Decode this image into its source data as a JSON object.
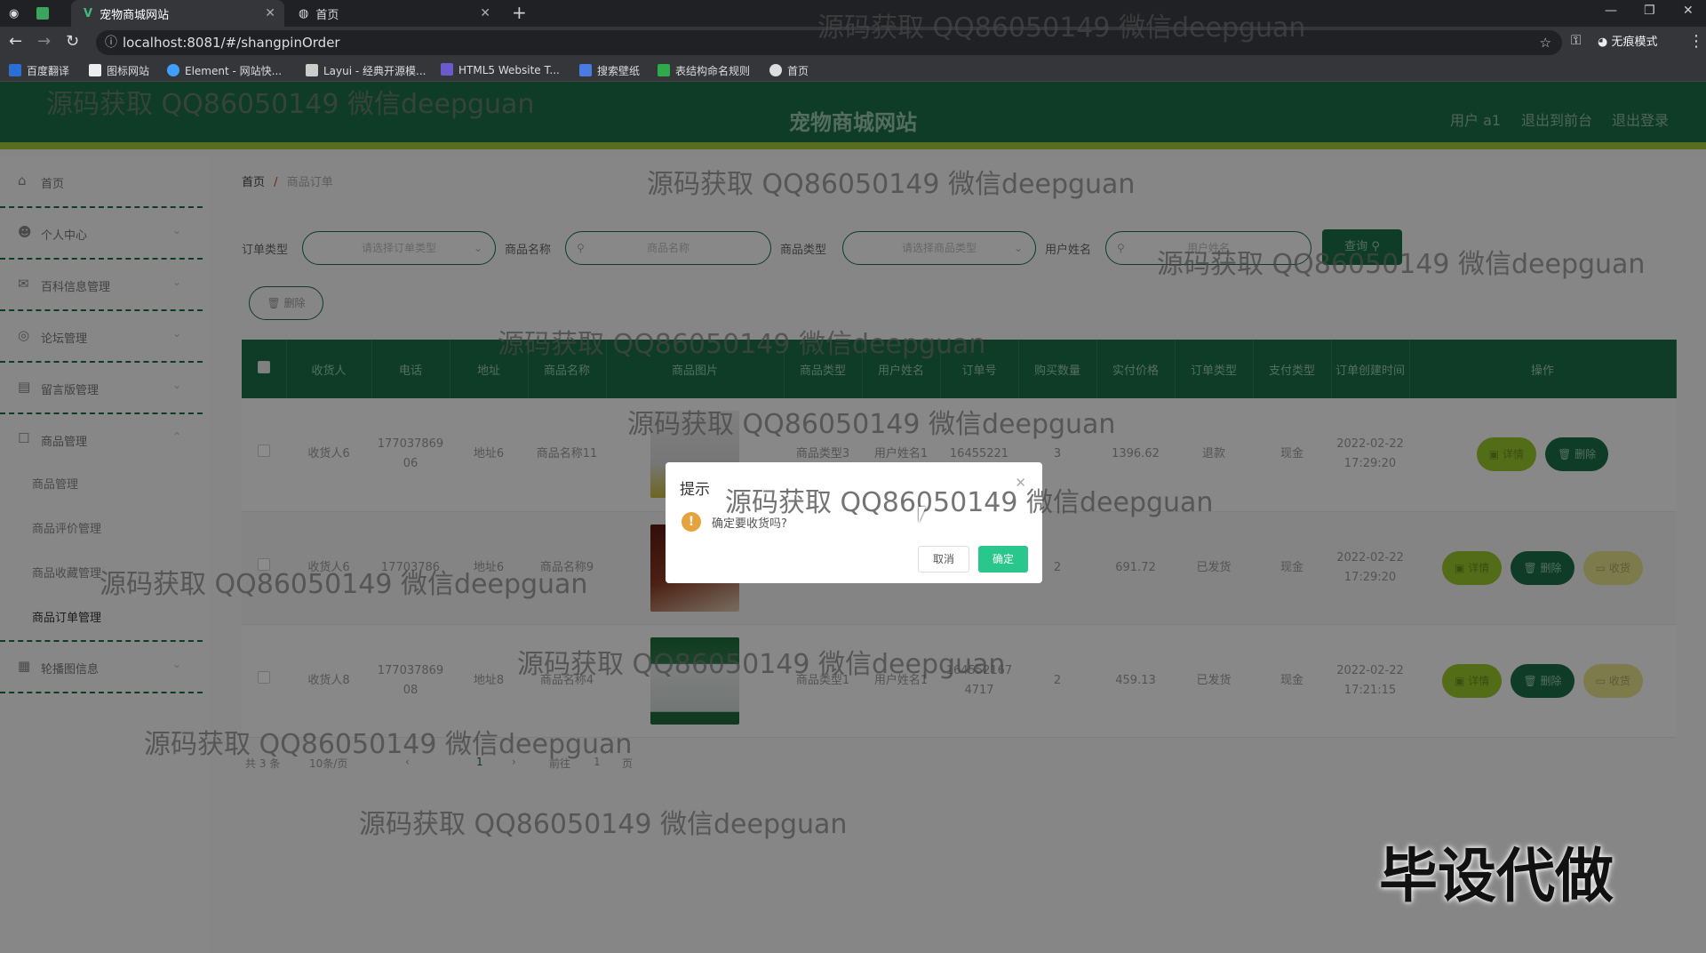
{
  "browser": {
    "tabs": [
      {
        "title": "宠物商城网站",
        "active": true
      },
      {
        "title": "首页",
        "active": false
      }
    ],
    "url": "localhost:8081/#/shangpinOrder",
    "incognito_label": "无痕模式",
    "bookmarks": [
      "百度翻译",
      "图标网站",
      "Element - 网站快...",
      "Layui - 经典开源模...",
      "HTML5 Website T...",
      "搜索壁纸",
      "表结构命名规则",
      "首页"
    ]
  },
  "header": {
    "title": "宠物商城网站",
    "user": "用户 a1",
    "to_front": "退出到前台",
    "logout": "退出登录"
  },
  "sidebar": {
    "items": [
      {
        "label": "首页",
        "icon": "home-icon"
      },
      {
        "label": "个人中心",
        "icon": "user-icon"
      },
      {
        "label": "百科信息管理",
        "icon": "mail-icon"
      },
      {
        "label": "论坛管理",
        "icon": "forum-icon"
      },
      {
        "label": "留言版管理",
        "icon": "message-icon"
      },
      {
        "label": "商品管理",
        "icon": "box-icon"
      },
      {
        "label": "轮播图信息",
        "icon": "grid-icon"
      }
    ],
    "sub_items": [
      "商品管理",
      "商品评价管理",
      "商品收藏管理",
      "商品订单管理"
    ]
  },
  "breadcrumb": {
    "home": "首页",
    "sep": "/",
    "current": "商品订单"
  },
  "filters": {
    "order_type_label": "订单类型",
    "order_type_placeholder": "请选择订单类型",
    "product_name_label": "商品名称",
    "product_name_placeholder": "商品名称",
    "product_type_label": "商品类型",
    "product_type_placeholder": "请选择商品类型",
    "user_name_label": "用户姓名",
    "user_name_placeholder": "用户姓名",
    "search_label": "查询",
    "delete_label": "删除"
  },
  "table": {
    "headers": [
      "收货人",
      "电话",
      "地址",
      "商品名称",
      "商品图片",
      "商品类型",
      "用户姓名",
      "订单号",
      "购买数量",
      "实付价格",
      "订单类型",
      "支付类型",
      "订单创建时间",
      "操作"
    ],
    "rows": [
      {
        "receiver": "收货人6",
        "phone": "17703786906",
        "address": "地址6",
        "product": "商品名称11",
        "ptype": "商品类型3",
        "user": "用户姓名1",
        "order_no": "16455221",
        "qty": "3",
        "price": "1396.62",
        "otype": "退款",
        "pay": "现金",
        "created": "2022-02-22 17:29:20",
        "ops": [
          "详情",
          "删除"
        ]
      },
      {
        "receiver": "收货人6",
        "phone": "17703786",
        "address": "地址6",
        "product": "商品名称9",
        "ptype": "",
        "user": "",
        "order_no": "",
        "qty": "2",
        "price": "691.72",
        "otype": "已发货",
        "pay": "现金",
        "created": "2022-02-22 17:29:20",
        "ops": [
          "详情",
          "删除",
          "收货"
        ]
      },
      {
        "receiver": "收货人8",
        "phone": "17703786908",
        "address": "地址8",
        "product": "商品名称4",
        "ptype": "商品类型1",
        "user": "用户姓名1",
        "order_no": "1645521674717",
        "qty": "2",
        "price": "459.13",
        "otype": "已发货",
        "pay": "现金",
        "created": "2022-02-22 17:21:15",
        "ops": [
          "详情",
          "删除",
          "收货"
        ]
      }
    ]
  },
  "pager": {
    "total": "共 3 条",
    "size": "10条/页",
    "prev": "‹",
    "page": "1",
    "next": "›",
    "goto": "前往",
    "goto_page": "1",
    "page_unit": "页"
  },
  "dialog": {
    "title": "提示",
    "message": "确定要收货吗?",
    "cancel": "取消",
    "confirm": "确定"
  },
  "watermarks": {
    "text": "源码获取 QQ86050149 微信deepguan",
    "badge": "毕设代做"
  },
  "colors": {
    "primary": "#1d6e45",
    "accent": "#a3c63a",
    "confirm": "#29c78c",
    "warning": "#e6a23c"
  }
}
